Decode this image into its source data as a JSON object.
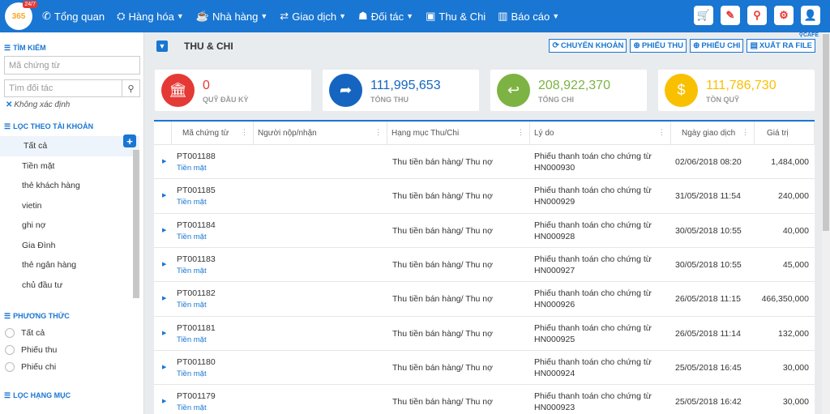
{
  "logo": {
    "text": "365",
    "badge": "24/7"
  },
  "nav": [
    {
      "icon": "✆",
      "label": "Tổng quan",
      "caret": false
    },
    {
      "icon": "⛭",
      "label": "Hàng hóa",
      "caret": true
    },
    {
      "icon": "☕",
      "label": "Nhà hàng",
      "caret": true
    },
    {
      "icon": "⇄",
      "label": "Giao dịch",
      "caret": true
    },
    {
      "icon": "☗",
      "label": "Đối tác",
      "caret": true
    },
    {
      "icon": "▣",
      "label": "Thu & Chi",
      "caret": false
    },
    {
      "icon": "▥",
      "label": "Báo cáo",
      "caret": true
    }
  ],
  "cafe_tag": "CAFE",
  "sidebar": {
    "search_title": "TÌM KIẾM",
    "doc_placeholder": "Mã chứng từ",
    "partner_placeholder": "Tìm đối tác",
    "unknown_label": "Không xác định",
    "account_title": "LỌC THEO TÀI KHOẢN",
    "accounts": [
      "Tất cả",
      "Tiền mặt",
      "thẻ khách hàng",
      "vietin",
      "ghi nợ",
      "Gia Đình",
      "thẻ ngân hàng",
      "chủ đầu tư"
    ],
    "method_title": "PHƯƠNG THỨC",
    "methods": [
      "Tất cả",
      "Phiếu thu",
      "Phiếu chi"
    ],
    "category_title": "LỌC HẠNG MỤC"
  },
  "main": {
    "title": "THU & CHI",
    "actions": [
      {
        "icon": "⟳",
        "label": "CHUYỂN KHOẢN"
      },
      {
        "icon": "⊕",
        "label": "PHIẾU THU"
      },
      {
        "icon": "⊕",
        "label": "PHIẾU CHI"
      },
      {
        "icon": "▤",
        "label": "XUẤT RA FILE"
      }
    ]
  },
  "cards": [
    {
      "value": "0",
      "label": "QUỸ ĐẦU KỲ",
      "color": "#e53935",
      "icon": "🏛"
    },
    {
      "value": "111,995,653",
      "label": "TỔNG THU",
      "color": "#1565c0",
      "icon": "➦"
    },
    {
      "value": "208,922,370",
      "label": "TỔNG CHI",
      "color": "#7cb342",
      "icon": "↩"
    },
    {
      "value": "111,786,730",
      "label": "TỒN QUỸ",
      "color": "#f9c000",
      "icon": "$"
    }
  ],
  "table": {
    "columns": [
      "Mã chứng từ",
      "Người nộp/nhận",
      "Hạng mục Thu/Chi",
      "Lý do",
      "Ngày giao dịch",
      "Giá trị"
    ],
    "rows": [
      {
        "code": "PT001188",
        "account": "Tiền mặt",
        "category": "Thu tiền bán hàng/ Thu nợ",
        "reason1": "Phiếu thanh toán cho chứng từ",
        "reason2": "HN000930",
        "date": "02/06/2018 08:20",
        "value": "1,484,000"
      },
      {
        "code": "PT001185",
        "account": "Tiền mặt",
        "category": "Thu tiền bán hàng/ Thu nợ",
        "reason1": "Phiếu thanh toán cho chứng từ",
        "reason2": "HN000929",
        "date": "31/05/2018 11:54",
        "value": "240,000"
      },
      {
        "code": "PT001184",
        "account": "Tiền mặt",
        "category": "Thu tiền bán hàng/ Thu nợ",
        "reason1": "Phiếu thanh toán cho chứng từ",
        "reason2": "HN000928",
        "date": "30/05/2018 10:55",
        "value": "40,000"
      },
      {
        "code": "PT001183",
        "account": "Tiền mặt",
        "category": "Thu tiền bán hàng/ Thu nợ",
        "reason1": "Phiếu thanh toán cho chứng từ",
        "reason2": "HN000927",
        "date": "30/05/2018 10:55",
        "value": "45,000"
      },
      {
        "code": "PT001182",
        "account": "Tiền mặt",
        "category": "Thu tiền bán hàng/ Thu nợ",
        "reason1": "Phiếu thanh toán cho chứng từ",
        "reason2": "HN000926",
        "date": "26/05/2018 11:15",
        "value": "466,350,000"
      },
      {
        "code": "PT001181",
        "account": "Tiền mặt",
        "category": "Thu tiền bán hàng/ Thu nợ",
        "reason1": "Phiếu thanh toán cho chứng từ",
        "reason2": "HN000925",
        "date": "26/05/2018 11:14",
        "value": "132,000"
      },
      {
        "code": "PT001180",
        "account": "Tiền mặt",
        "category": "Thu tiền bán hàng/ Thu nợ",
        "reason1": "Phiếu thanh toán cho chứng từ",
        "reason2": "HN000924",
        "date": "25/05/2018 16:45",
        "value": "30,000"
      },
      {
        "code": "PT001179",
        "account": "Tiền mặt",
        "category": "Thu tiền bán hàng/ Thu nợ",
        "reason1": "Phiếu thanh toán cho chứng từ",
        "reason2": "HN000923",
        "date": "25/05/2018 16:42",
        "value": "30,000"
      }
    ]
  }
}
